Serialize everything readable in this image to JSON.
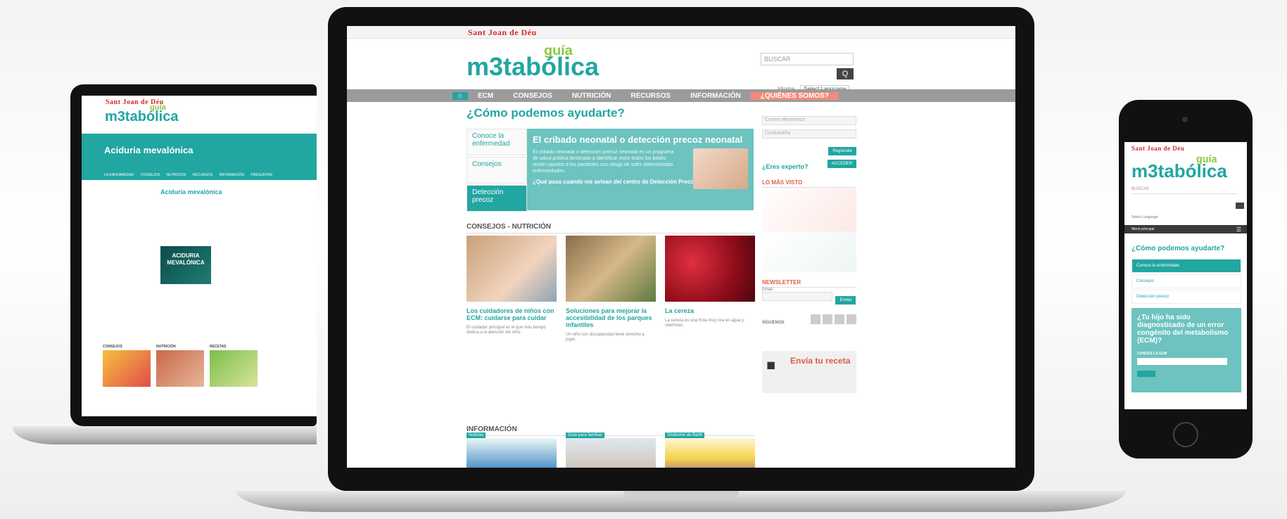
{
  "brand": {
    "sjd": "Sant Joan de Déu",
    "logo": "m3tabólica",
    "logo_sup": "guía"
  },
  "main": {
    "search_placeholder": "BUSCAR",
    "search_button": "Q",
    "language": {
      "label": "Idioma",
      "value": "Select Language"
    },
    "nav": [
      "ECM",
      "CONSEJOS",
      "NUTRICIÓN",
      "RECURSOS",
      "INFORMACIÓN",
      "¿QUIÉNES SOMOS?"
    ],
    "title": "¿Cómo podemos ayudarte?",
    "tabs": [
      "Conoce la enfermedad",
      "Consejos",
      "Detección precoz"
    ],
    "feature": {
      "title": "El cribado neonatal o detección precoz neonatal",
      "body": "El cribado neonatal o detección precoz neonatal es un programa de salud pública destinado a identificar entre todos los bebés recién nacidos a los pacientes con riesgo de sufrir determinadas enfermedades.",
      "link": "¿Qué pasa cuando me avisan del centro de Detección Precoz?"
    },
    "section_consejos": "CONSEJOS - NUTRICIÓN",
    "cards": [
      {
        "title": "Los cuidadores de niños con ECM: cuidarse para cuidar",
        "body": "El cuidador principal es el que más tiempo dedica a la atención del niño."
      },
      {
        "title": "Soluciones para mejorar la accesibilidad de los parques infantiles",
        "body": "Un niño con discapacidad tiene derecho a jugar."
      },
      {
        "title": "La cereza",
        "body": "La cereza es una fruta muy rica en agua y vitaminas."
      }
    ],
    "section_info": "INFORMACIÓN",
    "info_tags": [
      "Noticias",
      "Guía para familias",
      "Síndrome de Barth"
    ],
    "right": {
      "email_placeholder": "Correo electrónico",
      "password_placeholder": "Contraseña",
      "register_button": "Regístrate",
      "experto": "¿Eres experto?",
      "access_button": "ACCEDER",
      "most_viewed": "LO MÁS VISTO",
      "newsletter": "NEWSLETTER",
      "email_label": "Email",
      "send_button": "Enviar",
      "siguenos": "SÍGUENOS",
      "recipe_title": "Envía tu receta"
    }
  },
  "left": {
    "page_title": "Aciduria mevalónica",
    "subnav": [
      "LA ENFERMEDAD",
      "CONSEJOS",
      "NUTRICIÓN",
      "RECURSOS",
      "INFORMACIÓN",
      "PREGUNTAS"
    ],
    "heading": "Aciduria mevalónica",
    "image_caption": "ACIDURIA MEVALÓNICA",
    "thumbs": [
      "CONSEJOS",
      "NUTRICIÓN",
      "RECETAS"
    ]
  },
  "phone": {
    "menu": "Menú principal",
    "title": "¿Cómo podemos ayudarte?",
    "items": [
      "Conoce la enfermedad",
      "Consejos",
      "Detección precoz"
    ],
    "question": "¿Tu hijo ha sido diagnosticado de un error congénito del metabolismo (ECM)?",
    "label": "CONOCE LA ECM",
    "search_placeholder": "BUSCAR",
    "lang": "Select Language"
  },
  "colors": {
    "teal": "#21a6a1",
    "coral": "#f08b7a",
    "gray_nav": "#9b9b9b"
  }
}
